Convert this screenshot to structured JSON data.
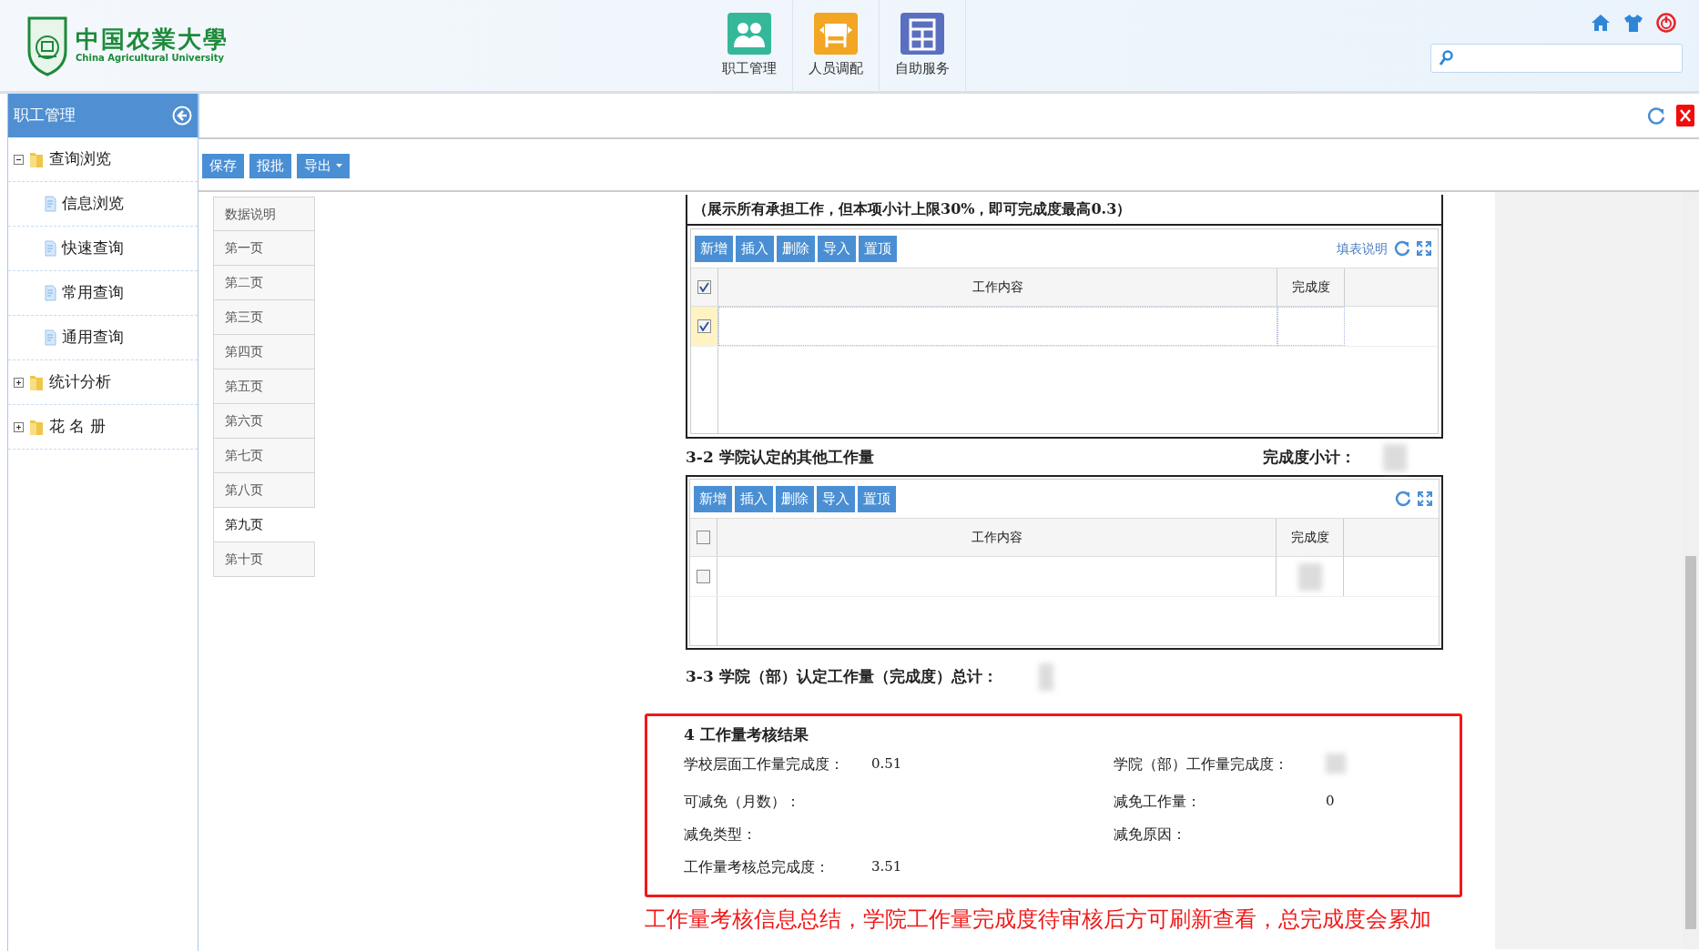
{
  "header": {
    "logo": {
      "chinese": "中国农業大學",
      "english": "China Agricultural University"
    },
    "nav": [
      {
        "label": "职工管理",
        "kind": "staff"
      },
      {
        "label": "人员调配",
        "kind": "transfer"
      },
      {
        "label": "自助服务",
        "kind": "service"
      }
    ]
  },
  "sidebar": {
    "title": "职工管理",
    "tree": [
      {
        "label": "查询浏览",
        "expanded": true,
        "children": [
          {
            "label": "信息浏览"
          },
          {
            "label": "快速查询"
          },
          {
            "label": "常用查询"
          },
          {
            "label": "通用查询"
          }
        ]
      },
      {
        "label": "统计分析",
        "expanded": false
      },
      {
        "label": "花 名 册",
        "expanded": false
      }
    ]
  },
  "toolbar": [
    {
      "label": "保存",
      "kind": "button"
    },
    {
      "label": "报批",
      "kind": "button"
    },
    {
      "label": "导出",
      "kind": "dropdown"
    }
  ],
  "pages": [
    {
      "label": "数据说明",
      "selected": false
    },
    {
      "label": "第一页",
      "selected": false
    },
    {
      "label": "第二页",
      "selected": false
    },
    {
      "label": "第三页",
      "selected": false
    },
    {
      "label": "第四页",
      "selected": false
    },
    {
      "label": "第五页",
      "selected": false
    },
    {
      "label": "第六页",
      "selected": false
    },
    {
      "label": "第七页",
      "selected": false
    },
    {
      "label": "第八页",
      "selected": false
    },
    {
      "label": "第九页",
      "selected": true
    },
    {
      "label": "第十页",
      "selected": false
    }
  ],
  "form": {
    "note": "（展示所有承担工作，但本项小计上限30%，即可完成度最高0.3）",
    "grid_1": {
      "buttons": [
        "新增",
        "插入",
        "删除",
        "导入",
        "置顶"
      ],
      "help_link": "填表说明",
      "columns": [
        "工作内容",
        "完成度"
      ],
      "all_checked": true,
      "rows": [
        {
          "checked": true,
          "selected": true,
          "value_hidden": false
        }
      ]
    },
    "section_3_2": {
      "title": "3-2 学院认定的其他工作量",
      "subtotal_label": "完成度小计：",
      "value_hidden": true
    },
    "grid_2": {
      "buttons": [
        "新增",
        "插入",
        "删除",
        "导入",
        "置顶"
      ],
      "columns": [
        "工作内容",
        "完成度"
      ],
      "all_checked": false,
      "rows": [
        {
          "checked": false,
          "selected": false,
          "value_hidden": true
        }
      ]
    },
    "section_3_3": {
      "label": "3-3 学院（部）认定工作量（完成度）总计：",
      "value_hidden": true
    },
    "result": {
      "title": "4 工作量考核结果",
      "fields": [
        {
          "label": "学校层面工作量完成度：",
          "value": "0.51"
        },
        {
          "label": "学院（部）工作量完成度：",
          "value_hidden": true
        },
        {
          "label": "可减免（月数）："
        },
        {
          "label": "减免工作量：",
          "value": "0"
        },
        {
          "label": "减免类型："
        },
        {
          "label": "减免原因："
        },
        {
          "label": "工作量考核总完成度：",
          "value": "3.51"
        }
      ]
    },
    "annotation": "工作量考核信息总结，学院工作量完成度待审核后方可刷新查看，总完成度会累加"
  }
}
